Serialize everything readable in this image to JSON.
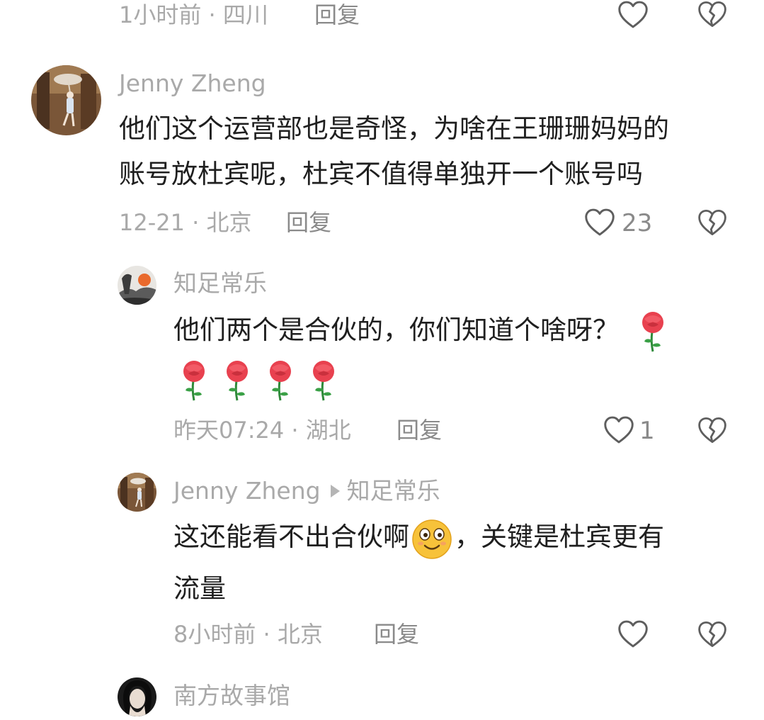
{
  "c0": {
    "time": "1小时前 · 四川",
    "reply": "回复"
  },
  "c1": {
    "author": "Jenny Zheng",
    "line1": "他们这个运营部也是奇怪，为啥在王珊珊妈妈的",
    "line2": "账号放杜宾呢，杜宾不值得单独开一个账号吗",
    "time": "12-21 · 北京",
    "reply": "回复",
    "likes": "23"
  },
  "c2": {
    "author": "知足常乐",
    "line1": "他们两个是合伙的，你们知道个啥呀？",
    "time": "昨天07:24 · 湖北",
    "reply": "回复",
    "likes": "1"
  },
  "c3": {
    "author": "Jenny Zheng",
    "reply_to": "知足常乐",
    "line1a": "这还能看不出合伙啊",
    "line1b": "，关键是杜宾更有",
    "line2": "流量",
    "time": "8小时前 · 北京",
    "reply": "回复"
  },
  "c4": {
    "author": "南方故事馆"
  },
  "icons": {
    "like": "heart-outline-icon",
    "dislike": "broken-heart-icon",
    "rose": "rose-emoji",
    "smile": "smiling-emoji"
  }
}
